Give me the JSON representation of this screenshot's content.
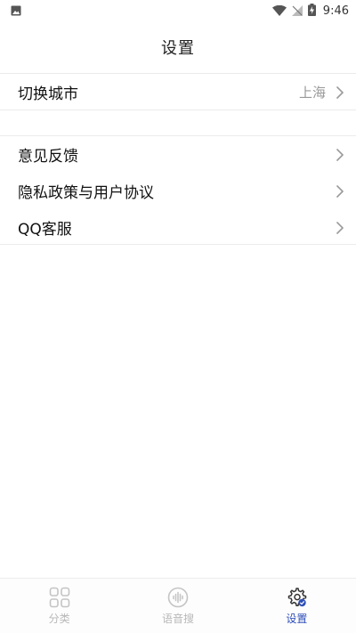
{
  "status_bar": {
    "time": "9:46",
    "icons": [
      "image-icon",
      "wifi-icon",
      "no-signal-icon",
      "battery-charging-icon"
    ]
  },
  "header": {
    "title": "设置"
  },
  "settings": {
    "city_row": {
      "label": "切换城市",
      "value": "上海"
    },
    "rows": [
      {
        "label": "意见反馈"
      },
      {
        "label": "隐私政策与用户协议"
      },
      {
        "label": "QQ客服"
      }
    ]
  },
  "bottom_nav": {
    "items": [
      {
        "label": "分类",
        "icon": "grid-icon",
        "active": false
      },
      {
        "label": "语音搜",
        "icon": "voice-search-icon",
        "active": false
      },
      {
        "label": "设置",
        "icon": "gear-icon",
        "active": true
      }
    ]
  },
  "colors": {
    "accent": "#2f4fb8",
    "inactive": "#b8b8b8",
    "divider": "#ebebeb",
    "secondary_text": "#999999"
  }
}
